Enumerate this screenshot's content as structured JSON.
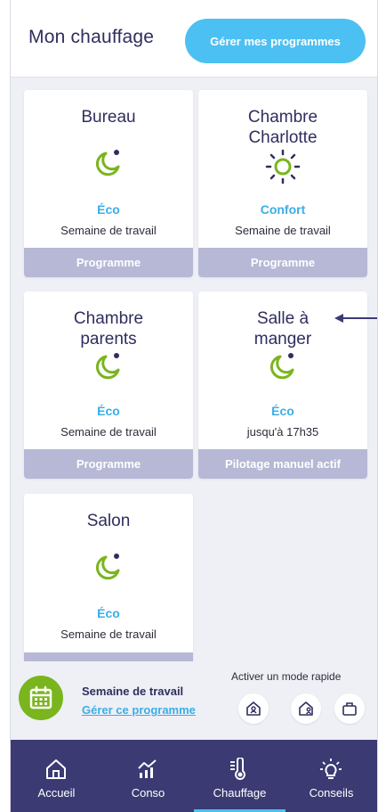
{
  "header": {
    "title": "Mon chauffage",
    "button_label": "Gérer mes programmes"
  },
  "rooms": [
    {
      "name": "Bureau",
      "mode": "Éco",
      "mode_icon": "moon-icon",
      "schedule": "Semaine de travail",
      "footer": "Programme"
    },
    {
      "name": "Chambre Charlotte",
      "mode": "Confort",
      "mode_icon": "sun-icon",
      "schedule": "Semaine de travail",
      "footer": "Programme"
    },
    {
      "name": "Chambre parents",
      "mode": "Éco",
      "mode_icon": "moon-icon",
      "schedule": "Semaine de travail",
      "footer": "Programme"
    },
    {
      "name": "Salle à manger",
      "mode": "Éco",
      "mode_icon": "moon-icon",
      "schedule": "jusqu'à 17h35",
      "footer": "Pilotage manuel actif"
    },
    {
      "name": "Salon",
      "mode": "Éco",
      "mode_icon": "moon-icon",
      "schedule": "Semaine de travail",
      "footer": ""
    }
  ],
  "quick": {
    "program_title": "Semaine de travail",
    "program_link": "Gérer ce programme",
    "label": "Activer un mode rapide",
    "buttons": [
      "home-mode-icon",
      "away-mode-icon",
      "travel-mode-icon"
    ]
  },
  "nav": {
    "items": [
      {
        "label": "Accueil",
        "icon": "home-icon"
      },
      {
        "label": "Conso",
        "icon": "chart-icon"
      },
      {
        "label": "Chauffage",
        "icon": "thermometer-icon"
      },
      {
        "label": "Conseils",
        "icon": "bulb-icon"
      }
    ],
    "active_index": 2
  },
  "colors": {
    "accent_blue": "#4cc0f2",
    "eco_green": "#7ab51d",
    "nav_bg": "#3b3a73",
    "card_footer": "#b6b8d6",
    "mode_text": "#3aaee7",
    "arrow": "#3b3a73"
  }
}
